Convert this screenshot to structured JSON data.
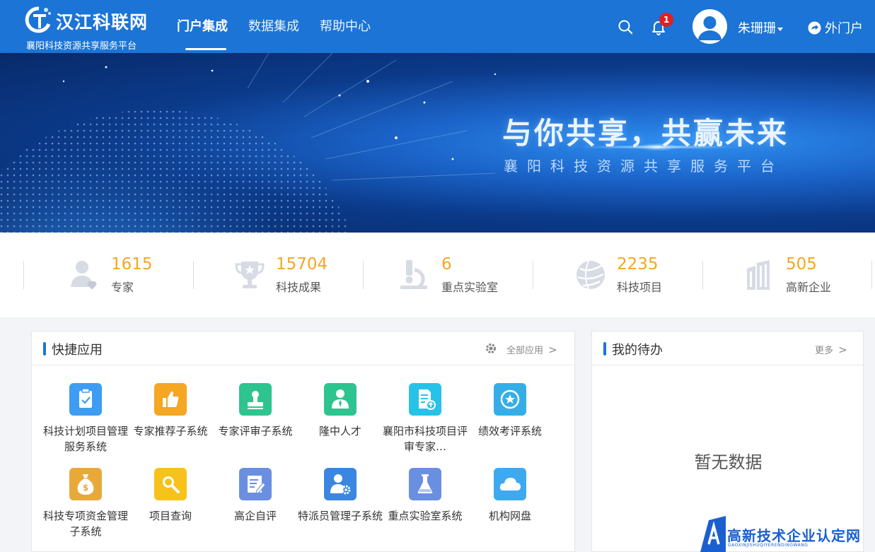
{
  "header": {
    "logo_title": "汉江科联网",
    "logo_subtitle": "襄阳科技资源共享服务平台",
    "nav": [
      {
        "label": "门户集成",
        "active": true
      },
      {
        "label": "数据集成",
        "active": false
      },
      {
        "label": "帮助中心",
        "active": false
      }
    ],
    "notification_count": "1",
    "username": "朱珊珊",
    "portal_link": "外门户",
    "icons": {
      "search": "search-icon",
      "bell": "bell-icon",
      "avatar": "user-avatar-icon",
      "portal": "arrow-circle-icon"
    },
    "accent_color": "#1b74d6"
  },
  "banner": {
    "title": "与你共享，共赢未来",
    "subtitle": "襄阳科技资源共享服务平台"
  },
  "stats": [
    {
      "value": "1615",
      "label": "专家",
      "icon": "expert-icon"
    },
    {
      "value": "15704",
      "label": "科技成果",
      "icon": "trophy-icon"
    },
    {
      "value": "6",
      "label": "重点实验室",
      "icon": "microscope-icon"
    },
    {
      "value": "2235",
      "label": "科技项目",
      "icon": "globe-icon"
    },
    {
      "value": "505",
      "label": "高新企业",
      "icon": "building-icon"
    }
  ],
  "quick_apps": {
    "title": "快捷应用",
    "all_link": "全部应用",
    "items": [
      {
        "label": "科技计划项目管理服务系统",
        "color": "#3d9df2",
        "icon": "clipboard-check-icon"
      },
      {
        "label": "专家推荐子系统",
        "color": "#f5a623",
        "icon": "thumbs-up-icon"
      },
      {
        "label": "专家评审子系统",
        "color": "#2ec48f",
        "icon": "stamp-icon"
      },
      {
        "label": "隆中人才",
        "color": "#2ec48f",
        "icon": "person-icon"
      },
      {
        "label": "襄阳市科技项目评审专家…",
        "color": "#27c2e8",
        "icon": "document-upload-icon"
      },
      {
        "label": "绩效考评系统",
        "color": "#35aee8",
        "icon": "star-badge-icon"
      },
      {
        "label": "科技专项资金管理子系统",
        "color": "#e8a93a",
        "icon": "money-bag-icon"
      },
      {
        "label": "项目查询",
        "color": "#f7c21c",
        "icon": "magnifier-icon"
      },
      {
        "label": "高企自评",
        "color": "#6b8fe0",
        "icon": "edit-note-icon"
      },
      {
        "label": "特派员管理子系统",
        "color": "#3a86e0",
        "icon": "user-gear-icon"
      },
      {
        "label": "重点实验室系统",
        "color": "#6b8fe0",
        "icon": "flask-icon"
      },
      {
        "label": "机构网盘",
        "color": "#3fa9f0",
        "icon": "cloud-icon"
      }
    ]
  },
  "todo": {
    "title": "我的待办",
    "more_link": "更多",
    "empty_text": "暂无数据"
  },
  "watermark": {
    "text": "高新技术企业认定网",
    "pinyin": "GAOXINJISHUQIYERENDINGWANG"
  }
}
